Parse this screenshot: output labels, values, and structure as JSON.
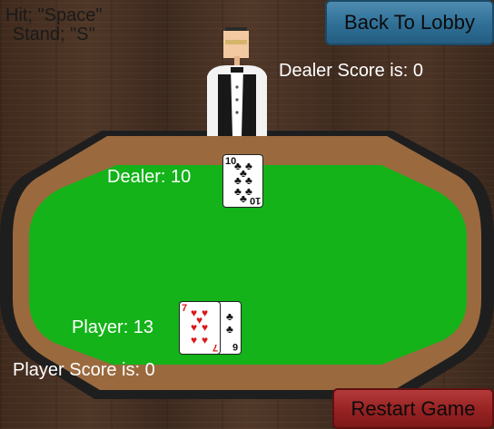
{
  "controls": {
    "line1": "Hit; \"Space\"",
    "line2": "Stand; \"S\""
  },
  "buttons": {
    "back_to_lobby": "Back To Lobby",
    "restart_game": "Restart Game"
  },
  "scores": {
    "dealer_score": "Dealer Score is: 0",
    "player_score": "Player Score is: 0"
  },
  "hands": {
    "dealer_label": "Dealer: 10",
    "player_label": "Player: 13",
    "dealer_cards": [
      {
        "rank": "10",
        "suit": "clubs"
      }
    ],
    "player_cards": [
      {
        "rank": "7",
        "suit": "hearts"
      },
      {
        "rank": "6",
        "suit": "clubs"
      }
    ]
  },
  "colors": {
    "felt": "#13b319",
    "rail": "#9a6a3e",
    "table_edge": "#1e1e1e",
    "back_button": "#2f6f96",
    "restart_button": "#962222",
    "text_light": "#ffffff"
  }
}
